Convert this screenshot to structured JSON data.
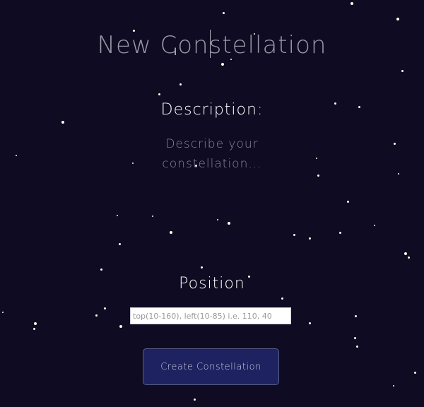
{
  "title_input": {
    "placeholder": "New Constellation"
  },
  "description": {
    "label": "Description:",
    "placeholder": "Describe your constellation..."
  },
  "position": {
    "label": "Position",
    "placeholder": "top(10-160), left(10-85) i.e. 110, 40"
  },
  "submit": {
    "label": "Create Constellation"
  },
  "colors": {
    "background": "#0f0b22",
    "star": "#fffbe8",
    "button": "#1e2260"
  }
}
